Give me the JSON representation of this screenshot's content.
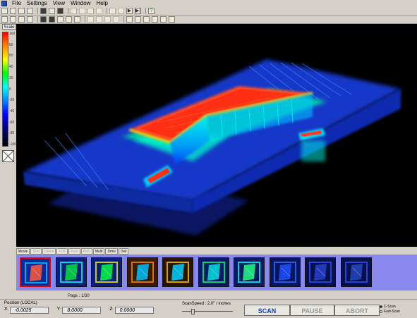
{
  "menubar": {
    "items": [
      {
        "label": "File"
      },
      {
        "label": "Settings"
      },
      {
        "label": "View"
      },
      {
        "label": "Window"
      },
      {
        "label": "Help"
      }
    ]
  },
  "toolbar1": {
    "play_icon": "▶",
    "fast_forward_icon": "▶|",
    "help_icon": "?"
  },
  "sidebar": {
    "scale_label": "Scale",
    "ticks": [
      "100",
      "80",
      "60",
      "40",
      "20",
      "0",
      "-20",
      "-40",
      "-60",
      "-80",
      "-100"
    ]
  },
  "tabs": [
    {
      "label": "Movie",
      "enabled": true
    },
    {
      "label": "Grid",
      "enabled": false
    },
    {
      "label": "Gmod",
      "enabled": false
    },
    {
      "label": "TOF",
      "enabled": false
    },
    {
      "label": "Prev",
      "enabled": false
    },
    {
      "label": "Refs",
      "enabled": false
    },
    {
      "label": "Multi",
      "enabled": true
    },
    {
      "label": "Dmis",
      "enabled": true
    },
    {
      "label": "Deli",
      "enabled": true
    }
  ],
  "thumbnails": {
    "count": 10,
    "selected_index": 0
  },
  "page_label": "Page : 1/30",
  "status": {
    "position_label": "Position (LOCAL)",
    "x_label": "X",
    "x_value": "-0.0025",
    "y_label": "Y",
    "y_value": "8.0000",
    "z_label": "Z",
    "z_value": "0.0000",
    "scan_speed_label": "ScanSpeed : 2.0\" / inches",
    "scan_speed_level": 0.2,
    "scan_button": "SCAN",
    "pause_button": "PAUSE",
    "abort_button": "ABORT",
    "radio1": "C-Scan",
    "radio2": "Fast-Scan",
    "radio_checked": 0
  },
  "colors": {
    "accent": "#1c3fae",
    "strip_background": "#8888ee",
    "viewport_background": "#000000"
  }
}
